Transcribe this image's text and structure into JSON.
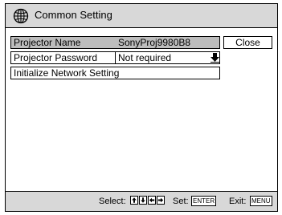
{
  "window": {
    "title": "Common Setting",
    "title_icon": "globe-icon"
  },
  "rows": {
    "projector_name": {
      "label": "Projector Name",
      "value": "SonyProj9980B8"
    },
    "projector_password": {
      "label": "Projector Password",
      "value": "Not required"
    },
    "initialize_network": {
      "label": "Initialize Network Setting"
    }
  },
  "buttons": {
    "close_label": "Close"
  },
  "footer": {
    "select_label": "Select:",
    "set_label": "Set:",
    "set_key": "ENTER",
    "exit_label": "Exit:",
    "exit_key": "MENU",
    "select_keys": [
      "up-arrow-key-icon",
      "down-arrow-key-icon",
      "left-arrow-key-icon",
      "right-arrow-key-icon"
    ]
  },
  "colors": {
    "title_bg": "#d8d8d8",
    "highlight_row": "#bdbdbd"
  }
}
